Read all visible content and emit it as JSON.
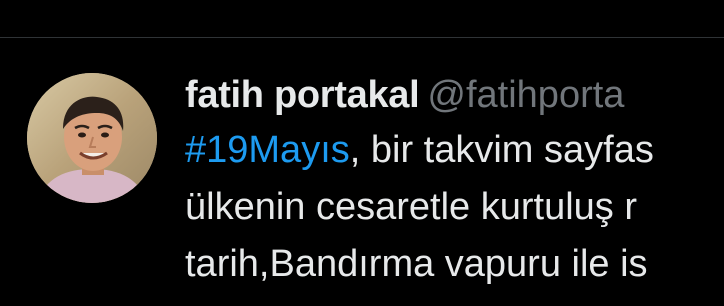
{
  "theme": {
    "background": "#000000",
    "text": "#e7e9ea",
    "muted": "#71767b",
    "link": "#1d9bf0",
    "divider": "#2f3336"
  },
  "tweet": {
    "author": {
      "display_name": "fatih portakal",
      "handle": "@fatihporta",
      "avatar_icon": "profile-photo"
    },
    "hashtag": "#19Mayıs",
    "line1_rest": ", bir takvim sayfas",
    "line2": "ülkenin cesaretle kurtuluş r",
    "line3": "tarih,Bandırma vapuru ile is"
  }
}
